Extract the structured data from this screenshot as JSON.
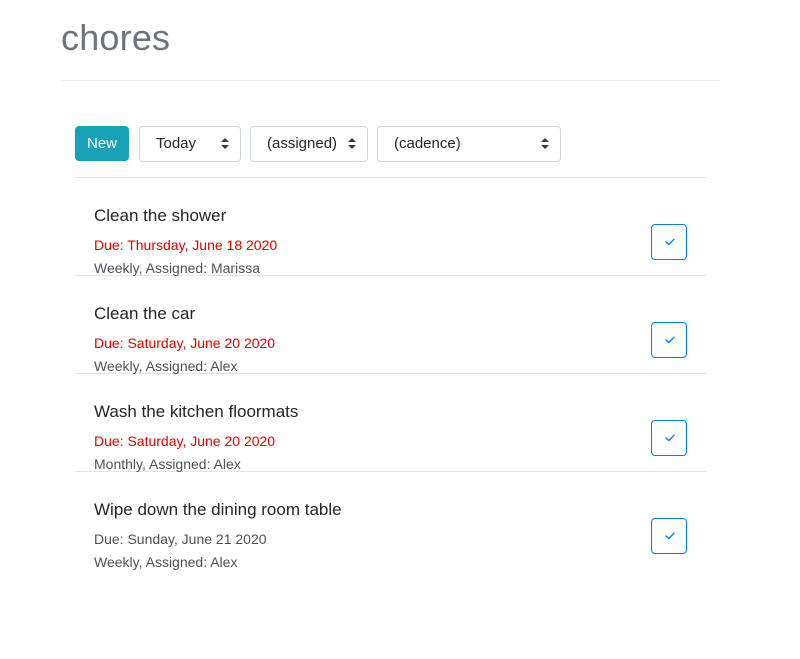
{
  "page": {
    "title": "chores"
  },
  "toolbar": {
    "new_label": "New",
    "day_filter": {
      "selected": "Today"
    },
    "assigned_filter": {
      "selected": "(assigned)"
    },
    "cadence_filter": {
      "selected": "(cadence)"
    }
  },
  "colors": {
    "accent": "#17a2b8",
    "overdue": "#dc0000",
    "check": "#007bff"
  },
  "chores": [
    {
      "title": "Clean the shower",
      "due": "Due: Thursday, June 18 2020",
      "overdue": true,
      "meta": "Weekly, Assigned: Marissa",
      "action_icon": "check-icon"
    },
    {
      "title": "Clean the car",
      "due": "Due: Saturday, June 20 2020",
      "overdue": true,
      "meta": "Weekly, Assigned: Alex",
      "action_icon": "check-icon"
    },
    {
      "title": "Wash the kitchen floormats",
      "due": "Due: Saturday, June 20 2020",
      "overdue": true,
      "meta": "Monthly, Assigned: Alex",
      "action_icon": "check-icon"
    },
    {
      "title": "Wipe down the dining room table",
      "due": "Due: Sunday, June 21 2020",
      "overdue": false,
      "meta": "Weekly, Assigned: Alex",
      "action_icon": "check-icon"
    }
  ]
}
